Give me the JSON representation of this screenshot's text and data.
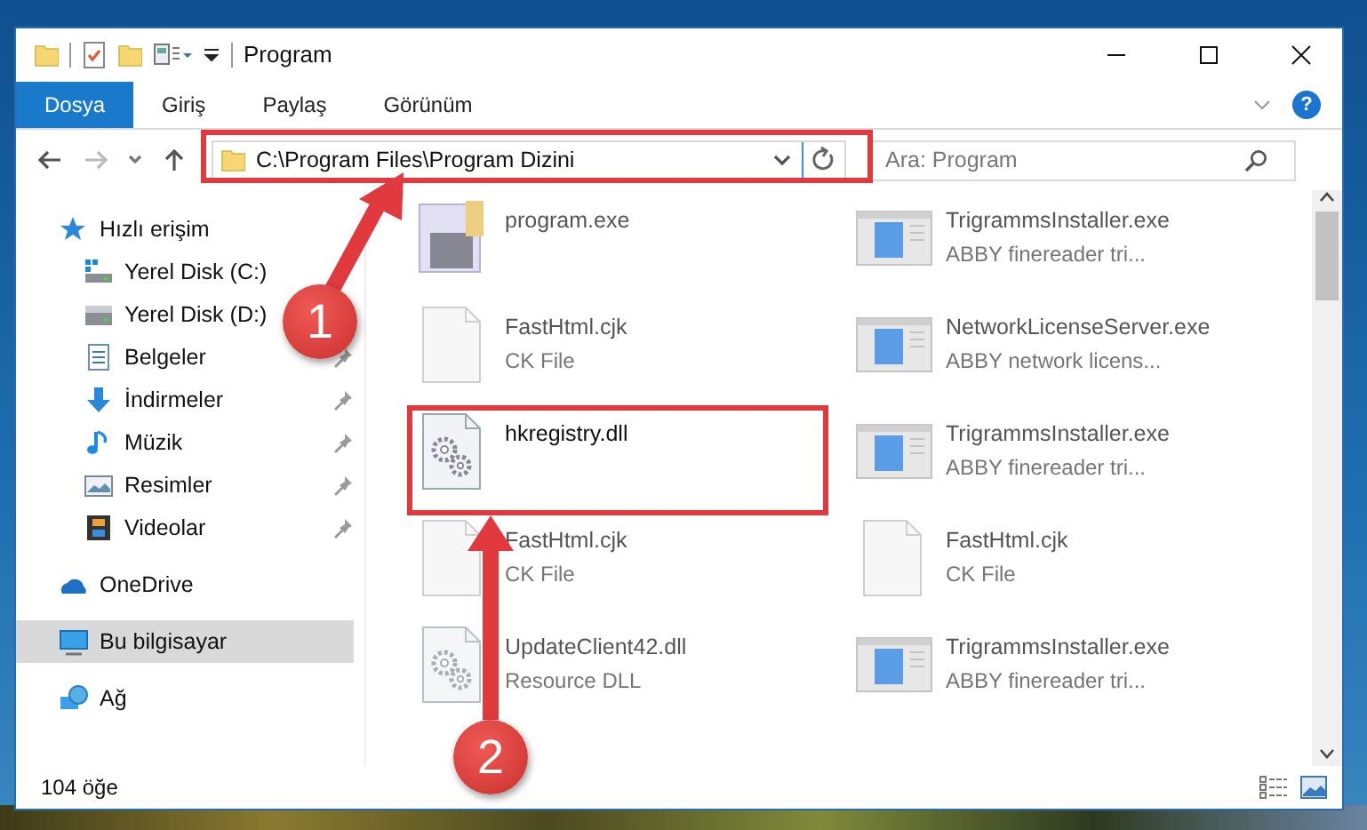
{
  "window": {
    "title": "Program"
  },
  "ribbon_tabs": [
    {
      "label": "Dosya",
      "selected": true
    },
    {
      "label": "Giriş",
      "selected": false
    },
    {
      "label": "Paylaş",
      "selected": false
    },
    {
      "label": "Görünüm",
      "selected": false
    }
  ],
  "help_button": {
    "label": "?"
  },
  "address_bar": {
    "path": "C:\\Program Files\\Program Dizini"
  },
  "search": {
    "placeholder": "Ara: Program"
  },
  "sidebar": {
    "items": [
      {
        "label": "Hızlı erişim",
        "kind": "quick",
        "selected": false,
        "children": [
          {
            "label": "Yerel Disk (C:)",
            "kind": "system-drive",
            "pinned": false,
            "selected": false
          },
          {
            "label": "Yerel Disk (D:)",
            "kind": "drive",
            "pinned": false,
            "selected": false
          },
          {
            "label": "Belgeler",
            "kind": "documents",
            "pinned": true,
            "selected": false
          },
          {
            "label": "İndirmeler",
            "kind": "downloads",
            "pinned": true,
            "selected": false
          },
          {
            "label": "Müzik",
            "kind": "music",
            "pinned": true,
            "selected": false
          },
          {
            "label": "Resimler",
            "kind": "pictures",
            "pinned": true,
            "selected": false
          },
          {
            "label": "Videolar",
            "kind": "videos",
            "pinned": true,
            "selected": false
          }
        ]
      },
      {
        "label": "OneDrive",
        "kind": "cloud",
        "selected": false
      },
      {
        "label": "Bu bilgisayar",
        "kind": "computer",
        "selected": true
      },
      {
        "label": "Ağ",
        "kind": "network",
        "selected": false
      }
    ]
  },
  "files": [
    {
      "name": "program.exe",
      "kind": "program",
      "blurred": true
    },
    {
      "name": "TrigrammsInstaller.exe",
      "description": "ABBY finereader tri...",
      "kind": "installer",
      "blurred": true
    },
    {
      "name": "FastHtml.cjk",
      "description": "CK File",
      "kind": "blank",
      "blurred": true
    },
    {
      "name": "NetworkLicenseServer.exe",
      "description": "ABBY network licens...",
      "kind": "installer",
      "blurred": true
    },
    {
      "name": "hkregistry.dll",
      "kind": "dll",
      "blurred": false,
      "highlighted": true
    },
    {
      "name": "TrigrammsInstaller.exe",
      "description": "ABBY finereader tri...",
      "kind": "installer",
      "blurred": true
    },
    {
      "name": "FastHtml.cjk",
      "description": "CK File",
      "kind": "blank",
      "blurred": true
    },
    {
      "name": "FastHtml.cjk",
      "description": "CK File",
      "kind": "blank",
      "blurred": true
    },
    {
      "name": "UpdateClient42.dll",
      "description": "Resource DLL",
      "kind": "dll",
      "blurred": true
    },
    {
      "name": "TrigrammsInstaller.exe",
      "description": "ABBY finereader tri...",
      "kind": "installer",
      "blurred": true
    }
  ],
  "status_bar": {
    "item_count": "104 öğe"
  },
  "annotations": [
    {
      "number": "1"
    },
    {
      "number": "2"
    }
  ]
}
